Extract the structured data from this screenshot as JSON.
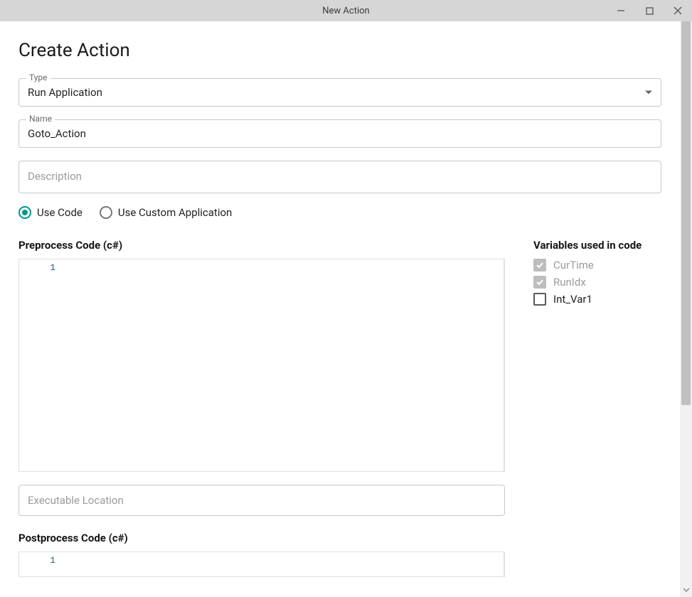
{
  "window": {
    "title": "New Action"
  },
  "page": {
    "heading": "Create Action",
    "fields": {
      "type_label": "Type",
      "type_value": "Run Application",
      "name_label": "Name",
      "name_value": "Goto_Action",
      "description_placeholder": "Description",
      "executable_placeholder": "Executable Location"
    },
    "radios": {
      "use_code": "Use Code",
      "use_custom_app": "Use Custom Application"
    },
    "sections": {
      "preprocess_title": "Preprocess Code (c#)",
      "postprocess_title": "Postprocess Code (c#)",
      "variables_title": "Variables used in code"
    },
    "code": {
      "pre_line_numbers": [
        "1"
      ],
      "post_line_numbers": [
        "1"
      ]
    },
    "variables": [
      {
        "label": "CurTime",
        "checked": true,
        "disabled": true
      },
      {
        "label": "RunIdx",
        "checked": true,
        "disabled": true
      },
      {
        "label": "Int_Var1",
        "checked": false,
        "disabled": false
      }
    ]
  }
}
